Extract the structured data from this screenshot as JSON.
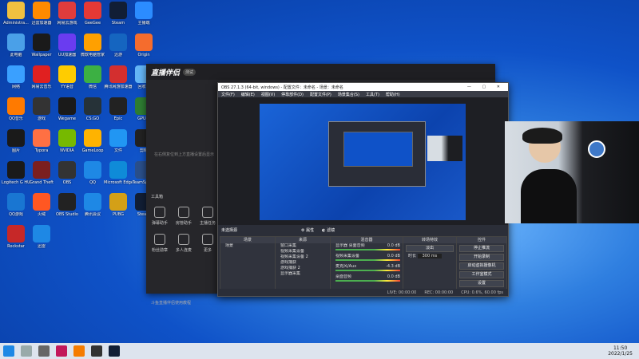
{
  "desktop_icons": [
    {
      "label": "Administra...",
      "color": "#f0c040"
    },
    {
      "label": "迅雷加速器",
      "color": "#ff8a00"
    },
    {
      "label": "网易云游戏",
      "color": "#e03c3c"
    },
    {
      "label": "GeeGee",
      "color": "#e53935"
    },
    {
      "label": "Steam",
      "color": "#111e35"
    },
    {
      "label": "主播端",
      "color": "#2b8cff"
    },
    {
      "label": "此电脑",
      "color": "#4aa0e8"
    },
    {
      "label": "Wallpaper",
      "color": "#1a1a1a"
    },
    {
      "label": "UU加速器",
      "color": "#6a3cf0"
    },
    {
      "label": "微软电脑管家",
      "color": "#ffa000"
    },
    {
      "label": "迅游",
      "color": "#1565c0"
    },
    {
      "label": "Origin",
      "color": "#f56c2d"
    },
    {
      "label": "网络",
      "color": "#3aa0ff"
    },
    {
      "label": "网易云音乐",
      "color": "#e02020"
    },
    {
      "label": "YY语音",
      "color": "#ffcc00"
    },
    {
      "label": "微信",
      "color": "#3cb043"
    },
    {
      "label": "腾讯网游加速器",
      "color": "#d32f2f"
    },
    {
      "label": "回收站",
      "color": "#64b5f6"
    },
    {
      "label": "QQ音乐",
      "color": "#ff7a00"
    },
    {
      "label": "游戏",
      "color": "#333"
    },
    {
      "label": "Wegame",
      "color": "#1a1a1a"
    },
    {
      "label": "CS:GO",
      "color": "#263238"
    },
    {
      "label": "Epic",
      "color": "#222"
    },
    {
      "label": "GPU-Z",
      "color": "#2e7d32"
    },
    {
      "label": "图片",
      "color": "#1a1a1a"
    },
    {
      "label": "Typora",
      "color": "#ff7043"
    },
    {
      "label": "NVIDIA",
      "color": "#76b900"
    },
    {
      "label": "GameLoop",
      "color": "#ffb300"
    },
    {
      "label": "文件",
      "color": "#2196f3"
    },
    {
      "label": "剪映",
      "color": "#222"
    },
    {
      "label": "Logitech G HUB",
      "color": "#1a1a1a"
    },
    {
      "label": "Grand Theft",
      "color": "#7b1f1f"
    },
    {
      "label": "OBS",
      "color": "#333"
    },
    {
      "label": "QQ",
      "color": "#1e88e5"
    },
    {
      "label": "Microsoft Edge",
      "color": "#0f8bd8"
    },
    {
      "label": "TeamSpeak",
      "color": "#2a4f8a"
    },
    {
      "label": "QQ游戏",
      "color": "#1976d2"
    },
    {
      "label": "火绒",
      "color": "#ff5722"
    },
    {
      "label": "OBS Studio",
      "color": "#222"
    },
    {
      "label": "腾讯会议",
      "color": "#1e88e5"
    },
    {
      "label": "PUBG",
      "color": "#d4a017"
    },
    {
      "label": "Steam",
      "color": "#111e35"
    },
    {
      "label": "Rockstar",
      "color": "#c62828"
    },
    {
      "label": "迅雷",
      "color": "#1e88e5"
    }
  ],
  "streamer": {
    "logo": "直播伴侣",
    "version": "测试",
    "hint": "在右侧复位到上方直播设置后显示",
    "tools_label": "工具箱",
    "tools": [
      "弹幕助手",
      "房管助手",
      "主播任务",
      "粉丝勋章",
      "多人连麦",
      "更多"
    ],
    "footer": "斗鱼直播伴侣使用教程"
  },
  "obs": {
    "title": "OBS 27.1.3 (64-bit, windows) - 配置文件：未命名 - 场景：未命名",
    "menu": [
      "文件(F)",
      "编辑(E)",
      "视图(V)",
      "停靠部件(D)",
      "配置文件(P)",
      "场景集合(S)",
      "工具(T)",
      "帮助(H)"
    ],
    "source_name": "未选择源",
    "props": "属性",
    "filters": "滤镜",
    "docks": {
      "scenes": {
        "title": "场景",
        "items": [
          "场景"
        ]
      },
      "sources": {
        "title": "来源",
        "items": [
          "窗口采集",
          "视频采集设备",
          "视频采集设备 2",
          "游戏捕获",
          "游戏捕获 2",
          "显示器采集"
        ]
      },
      "mixer": {
        "title": "混音器",
        "items": [
          "显示器 桌面音频",
          "视频采集设备",
          "麦克风/Aux",
          "桌面音频"
        ],
        "db": [
          "0.0 dB",
          "0.0 dB",
          "-4.3 dB",
          "0.0 dB"
        ]
      },
      "transitions": {
        "title": "转场特效",
        "type": "淡出",
        "duration_label": "时长",
        "duration": "300 ms"
      },
      "controls": {
        "title": "控件",
        "buttons": [
          "停止推流",
          "开始录制",
          "启动虚拟摄像机",
          "工作室模式",
          "设置",
          "退出"
        ]
      }
    },
    "status": [
      "LIVE: 00:00:00",
      "REC: 00:00:00",
      "CPU: 0.6%, 60.00 fps"
    ]
  },
  "taskbar": {
    "time": "11:50",
    "date": "2022/1/25"
  }
}
